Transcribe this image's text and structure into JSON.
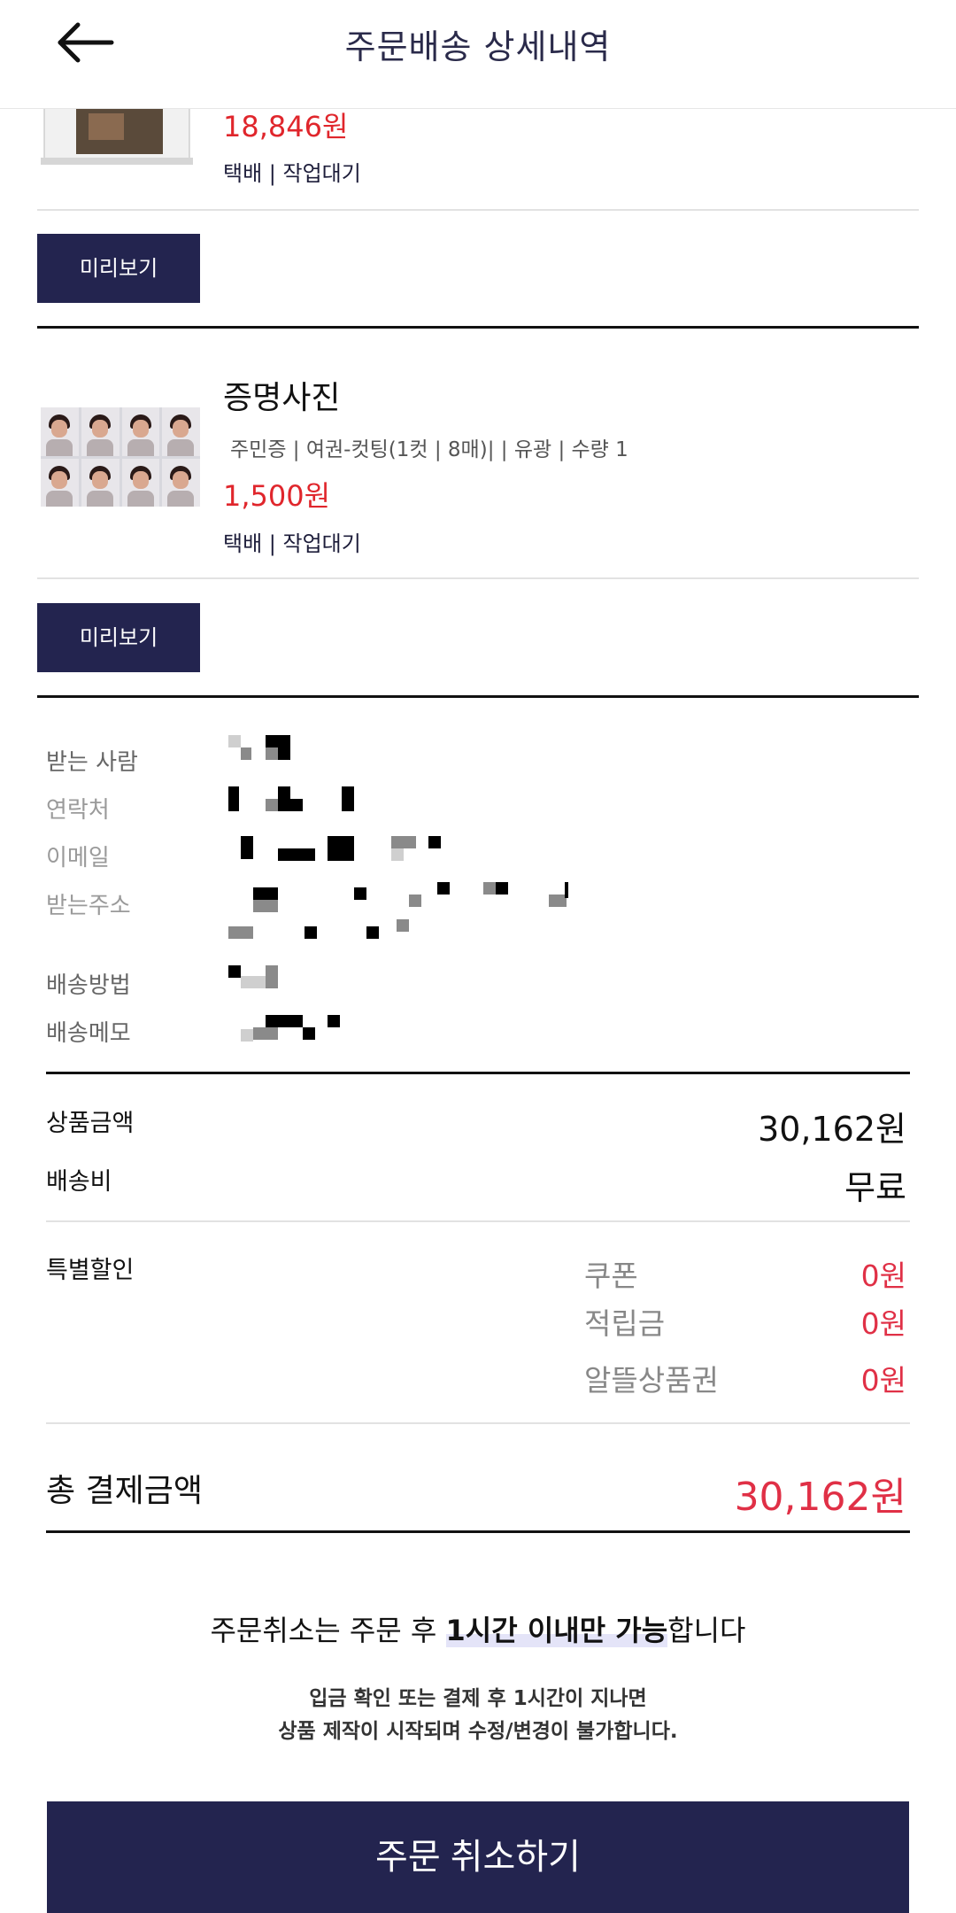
{
  "header": {
    "title": "주문배송 상세내역",
    "back_icon": "arrow-left-icon"
  },
  "items": [
    {
      "price": "18,846원",
      "shipping_status": "택배 | 작업대기",
      "preview_label": "미리보기"
    },
    {
      "title": "증명사진",
      "options": "주민증 | 여권-컷팅(1컷 | 8매)|  |  유광 | 수량 1",
      "price": "1,500원",
      "shipping_status": "택배 | 작업대기",
      "preview_label": "미리보기"
    }
  ],
  "delivery_info": {
    "recipient_label": "받는 사람",
    "contact_label": "연락처",
    "email_label": "이메일",
    "address_label": "받는주소",
    "method_label": "배송방법",
    "memo_label": "배송메모"
  },
  "summary": {
    "product_amount_label": "상품금액",
    "product_amount": "30,162원",
    "shipping_fee_label": "배송비",
    "shipping_fee": "무료",
    "special_discount_label": "특별할인",
    "coupon_label": "쿠폰",
    "coupon_value": "0원",
    "points_label": "적립금",
    "points_value": "0원",
    "gift_label": "알뜰상품권",
    "gift_value": "0원",
    "total_label": "총 결제금액",
    "total_value": "30,162원"
  },
  "notice": {
    "main_prefix": "주문취소는 주문 후 ",
    "main_strong": "1시간 이내만 가능",
    "main_suffix": "합니다",
    "sub_line1": "입금 확인 또는 결제 후 1시간이 지나면",
    "sub_line2": "상품 제작이 시작되며 수정/변경이 불가합니다."
  },
  "cancel_button": "주문 취소하기",
  "colors": {
    "accent": "#23244f",
    "price_red": "#e0262c",
    "discount_red": "#e03046"
  }
}
